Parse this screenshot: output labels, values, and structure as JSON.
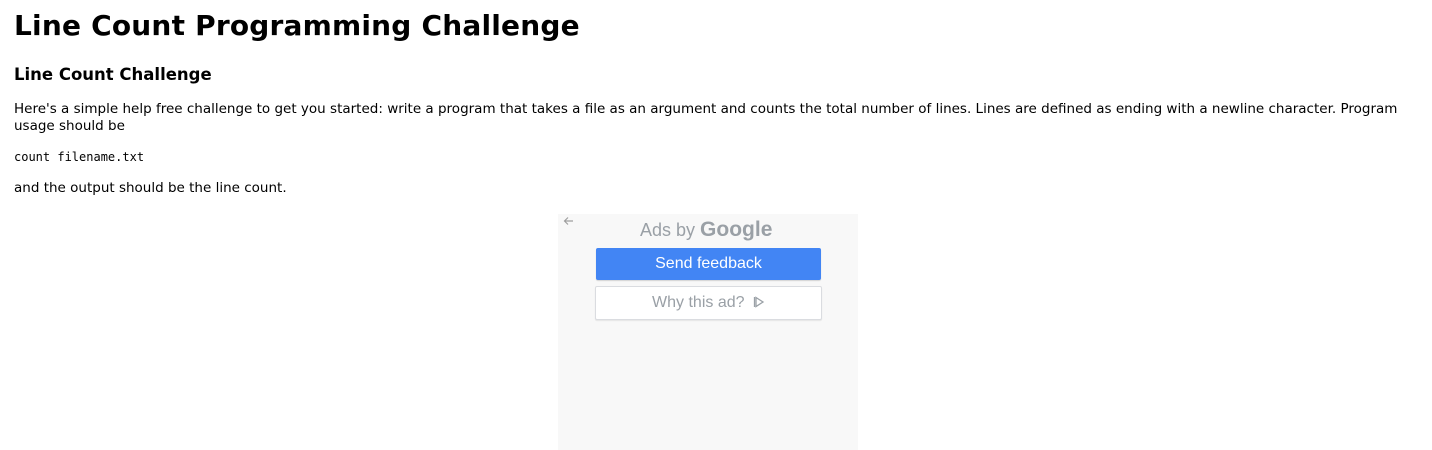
{
  "page": {
    "title": "Line Count Programming Challenge"
  },
  "section": {
    "heading": "Line Count Challenge",
    "intro": "Here's a simple help free challenge to get you started: write a program that takes a file as an argument and counts the total number of lines. Lines are defined as ending with a newline character. Program usage should be",
    "code": "count filename.txt",
    "outro": "and the output should be the line count."
  },
  "ad": {
    "back_icon": "arrow-left-icon",
    "ads_by_prefix": "Ads by",
    "ads_by_brand": "Google",
    "send_feedback_label": "Send feedback",
    "why_this_ad_label": "Why this ad?",
    "why_icon": "play-outline-icon",
    "colors": {
      "background": "#f8f8f8",
      "primary_button": "#4285f4",
      "muted_text": "#9aa0a6"
    }
  }
}
